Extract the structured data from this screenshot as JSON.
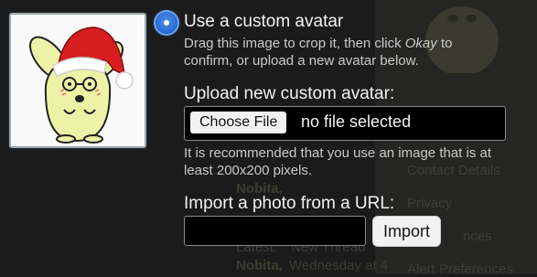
{
  "avatar_option": {
    "label": "Use a custom avatar",
    "hint": "Drag this image to crop it, then click Okay to confirm, or upload a new avatar below.",
    "hint_parts": [
      "Drag this image to crop it, then click ",
      "Okay",
      " to",
      "confirm, or upload a new avatar below."
    ],
    "selected": true
  },
  "upload": {
    "label": "Upload new custom avatar:",
    "button_label": "Choose File",
    "status": "no file selected",
    "recommendation_line1": "It is recommended that you use an image that is at",
    "recommendation_line2": "least 200x200 pixels."
  },
  "url_import": {
    "label": "Import a photo from a URL:",
    "value": "",
    "button_label": "Import"
  },
  "background": {
    "links": [
      "Contact Details",
      "Privacy",
      "nces",
      "Alert Preferences"
    ],
    "fragments": [
      "Nobita,",
      "Latest:",
      "New Thread",
      "Nobita,",
      "Wednesday at 4"
    ]
  },
  "colors": {
    "accent": "#2f6fd6",
    "page_bg": "#1b1b1b",
    "avatar_skin": "#eef2a6",
    "hat_red": "#d81e1e"
  }
}
